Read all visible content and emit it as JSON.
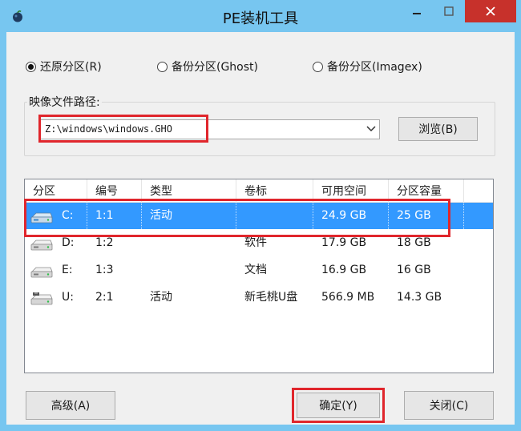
{
  "window": {
    "title": "PE装机工具"
  },
  "options": [
    {
      "label": "还原分区(R)",
      "selected": true
    },
    {
      "label": "备份分区(Ghost)",
      "selected": false
    },
    {
      "label": "备份分区(Imagex)",
      "selected": false
    }
  ],
  "image_path": {
    "label": "映像文件路径:",
    "value": "Z:\\windows\\windows.GHO",
    "browse_label": "浏览(B)"
  },
  "table": {
    "columns": [
      "分区",
      "编号",
      "类型",
      "卷标",
      "可用空间",
      "分区容量"
    ],
    "rows": [
      {
        "partition": "C:",
        "number": "1:1",
        "type": "活动",
        "label": "",
        "free": "24.9 GB",
        "capacity": "25 GB",
        "selected": true,
        "icon": "hard-drive-icon"
      },
      {
        "partition": "D:",
        "number": "1:2",
        "type": "",
        "label": "软件",
        "free": "17.9 GB",
        "capacity": "18 GB",
        "selected": false,
        "icon": "hard-drive-icon"
      },
      {
        "partition": "E:",
        "number": "1:3",
        "type": "",
        "label": "文档",
        "free": "16.9 GB",
        "capacity": "16 GB",
        "selected": false,
        "icon": "hard-drive-icon"
      },
      {
        "partition": "U:",
        "number": "2:1",
        "type": "活动",
        "label": "新毛桃U盘",
        "free": "566.9 MB",
        "capacity": "14.3 GB",
        "selected": false,
        "icon": "usb-drive-icon"
      }
    ]
  },
  "buttons": {
    "advanced": "高级(A)",
    "ok": "确定(Y)",
    "close": "关闭(C)"
  },
  "colors": {
    "chrome": "#77c6f0",
    "selection": "#3399ff",
    "highlight": "#e0262c",
    "close_button": "#c7312b"
  }
}
